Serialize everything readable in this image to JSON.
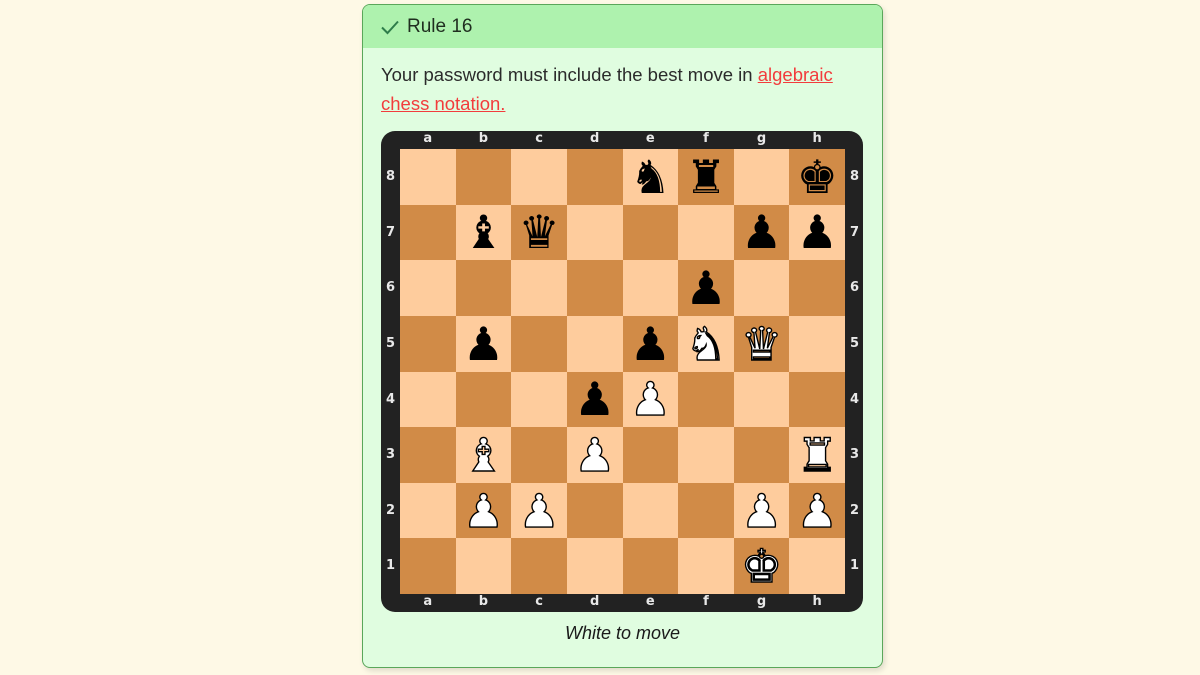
{
  "rule": {
    "status_icon": "check-icon",
    "title": "Rule 16",
    "text_before_link": "Your password must include the best move in ",
    "link_text": "algebraic chess notation."
  },
  "board": {
    "files": [
      "a",
      "b",
      "c",
      "d",
      "e",
      "f",
      "g",
      "h"
    ],
    "ranks": [
      "8",
      "7",
      "6",
      "5",
      "4",
      "3",
      "2",
      "1"
    ],
    "colors": {
      "light": "#fecc9d",
      "dark": "#d18b47",
      "frame": "#222222"
    },
    "pieces": {
      "e8": {
        "color": "b",
        "type": "knight",
        "glyph": "♞"
      },
      "f8": {
        "color": "b",
        "type": "rook",
        "glyph": "♜"
      },
      "h8": {
        "color": "b",
        "type": "king",
        "glyph": "♚"
      },
      "b7": {
        "color": "b",
        "type": "bishop",
        "glyph": "♝"
      },
      "c7": {
        "color": "b",
        "type": "queen",
        "glyph": "♛"
      },
      "g7": {
        "color": "b",
        "type": "pawn",
        "glyph": "♟"
      },
      "h7": {
        "color": "b",
        "type": "pawn",
        "glyph": "♟"
      },
      "f6": {
        "color": "b",
        "type": "pawn",
        "glyph": "♟"
      },
      "b5": {
        "color": "b",
        "type": "pawn",
        "glyph": "♟"
      },
      "e5": {
        "color": "b",
        "type": "pawn",
        "glyph": "♟"
      },
      "f5": {
        "color": "w",
        "type": "knight",
        "glyph": "♞"
      },
      "g5": {
        "color": "w",
        "type": "queen",
        "glyph": "♛"
      },
      "d4": {
        "color": "b",
        "type": "pawn",
        "glyph": "♟"
      },
      "e4": {
        "color": "w",
        "type": "pawn",
        "glyph": "♟"
      },
      "b3": {
        "color": "w",
        "type": "bishop",
        "glyph": "♝"
      },
      "d3": {
        "color": "w",
        "type": "pawn",
        "glyph": "♟"
      },
      "h3": {
        "color": "w",
        "type": "rook",
        "glyph": "♜"
      },
      "b2": {
        "color": "w",
        "type": "pawn",
        "glyph": "♟"
      },
      "c2": {
        "color": "w",
        "type": "pawn",
        "glyph": "♟"
      },
      "g2": {
        "color": "w",
        "type": "pawn",
        "glyph": "♟"
      },
      "h2": {
        "color": "w",
        "type": "pawn",
        "glyph": "♟"
      },
      "g1": {
        "color": "w",
        "type": "king",
        "glyph": "♚"
      }
    },
    "caption": "White to move"
  }
}
